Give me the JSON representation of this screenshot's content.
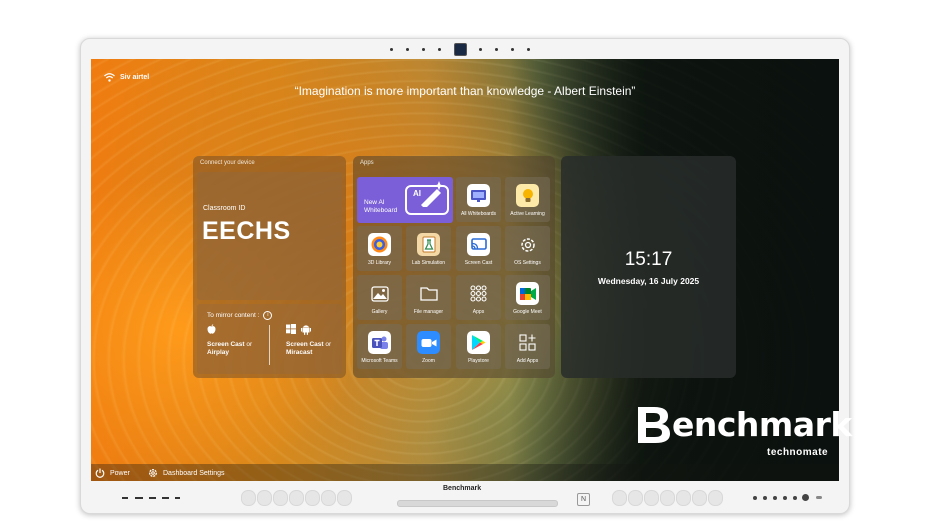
{
  "status": {
    "network": "Siv airtel"
  },
  "quote": "“Imagination is more important than knowledge - Albert Einstein”",
  "connect": {
    "title": "Connect your device",
    "classroom_label": "Classroom ID",
    "classroom_id": "EECHS",
    "mirror_label": "To mirror content :",
    "apple_method_a": "Screen Cast",
    "apple_or": " or",
    "apple_method_b": "Airplay",
    "android_method_a": "Screen Cast",
    "android_or": " or",
    "android_method_b": "Miracast"
  },
  "apps": {
    "title": "Apps",
    "whiteboard": {
      "label": "New AI Whiteboard",
      "badge": "AI"
    },
    "tiles": [
      {
        "label": "All Whiteboards",
        "icon": "whiteboard-icon"
      },
      {
        "label": "Active Learning",
        "icon": "lightbulb-icon"
      },
      {
        "label": "3D Library",
        "icon": "3d-library-icon"
      },
      {
        "label": "Lab Simulation",
        "icon": "lab-icon"
      },
      {
        "label": "Screen Cast",
        "icon": "cast-icon"
      },
      {
        "label": "OS Settings",
        "icon": "android-settings-icon"
      },
      {
        "label": "Gallery",
        "icon": "gallery-icon"
      },
      {
        "label": "File manager",
        "icon": "folder-icon"
      },
      {
        "label": "Apps",
        "icon": "apps-grid-icon"
      },
      {
        "label": "Google Meet",
        "icon": "google-meet-icon"
      },
      {
        "label": "Microsoft Teams",
        "icon": "teams-icon"
      },
      {
        "label": "Zoom",
        "icon": "zoom-icon"
      },
      {
        "label": "Playstore",
        "icon": "playstore-icon"
      },
      {
        "label": "Add Apps",
        "icon": "add-apps-icon"
      }
    ]
  },
  "clock": {
    "time": "15:17",
    "date": "Wednesday, 16 July 2025"
  },
  "bottom": {
    "power": "Power",
    "dashboard_settings": "Dashboard Settings"
  },
  "brand": {
    "name": "enchmark",
    "sub": "technomate",
    "bezel_logo": "Benchmark"
  },
  "colors": {
    "whiteboard_tile": "#7b5fd8",
    "accent_orange": "#f07c10"
  }
}
